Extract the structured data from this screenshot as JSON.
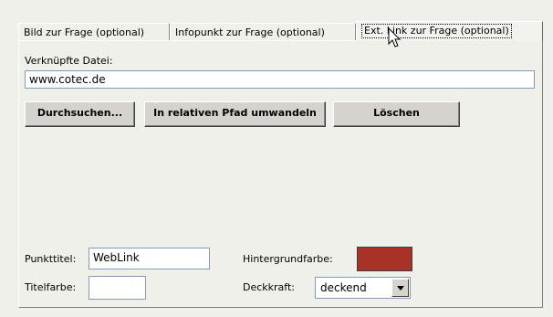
{
  "tabs": [
    {
      "label": "Bild zur Frage (optional)",
      "active": false
    },
    {
      "label": "Infopunkt zur Frage (optional)",
      "active": false
    },
    {
      "label": "Ext. Link zur Frage (optional)",
      "active": true
    }
  ],
  "link": {
    "file_label": "Verknüpfte Datei:",
    "file_value": "www.cotec.de"
  },
  "buttons": {
    "browse": "Durchsuchen...",
    "relative": "In relativen Pfad umwandeln",
    "delete": "Löschen"
  },
  "point": {
    "title_label": "Punkttitel:",
    "title_value": "WebLink",
    "title_color_label": "Titelfarbe:",
    "title_color": "#ffffff",
    "bg_color_label": "Hintergrundfarbe:",
    "bg_color": "#a83228",
    "opacity_label": "Deckkraft:",
    "opacity_value": "deckend"
  }
}
